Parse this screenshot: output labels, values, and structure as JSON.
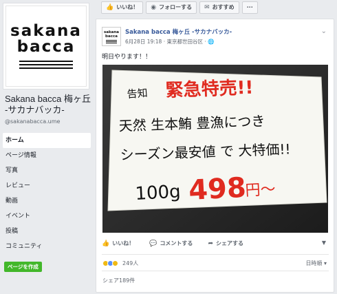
{
  "profile": {
    "logo_line1": "sakana",
    "logo_line2": "bacca",
    "name": "Sakana bacca 梅ヶ丘 -サカナバッカ-",
    "handle": "@sakanabacca.ume"
  },
  "nav": {
    "items": [
      {
        "label": "ホーム",
        "active": true
      },
      {
        "label": "ページ情報"
      },
      {
        "label": "写真"
      },
      {
        "label": "レビュー"
      },
      {
        "label": "動画"
      },
      {
        "label": "イベント"
      },
      {
        "label": "投稿"
      },
      {
        "label": "コミュニティ"
      }
    ],
    "create_page": "ページを作成"
  },
  "action_bar": {
    "like": "いいね！",
    "follow": "フォローする",
    "recommend": "おすすめ",
    "more": "···"
  },
  "post": {
    "author": "Sakana bacca 梅ヶ丘 -サカナバッカ-",
    "meta": "6月28日 19:18 · 東京都世田谷区 · 🌐",
    "text": "明日やります！！",
    "photo_text": {
      "line1": "告知",
      "line2": "緊急特売!!",
      "line3": "天然 生本鮪 豊漁につき",
      "line4": "シーズン最安値 で 大特価!!",
      "line5_prefix": "100g",
      "line5_price": "498",
      "line5_suffix": "円〜"
    },
    "actions": {
      "like": "いいね！",
      "comment": "コメントする",
      "share": "シェアする"
    },
    "reaction_count": "249人",
    "sort_label": "日時順 ▾",
    "shares": "シェア189件"
  },
  "colors": {
    "facebook_blue": "#365899",
    "create_green": "#42b72a",
    "marker_red": "#e02b20",
    "marker_black": "#111111"
  }
}
